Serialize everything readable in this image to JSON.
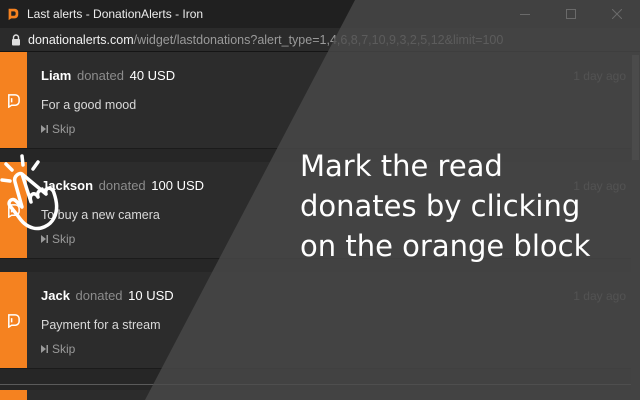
{
  "window": {
    "title": "Last alerts - DonationAlerts - Iron",
    "icon": "donationalerts-logo-icon",
    "accent": "#f58220"
  },
  "address": {
    "host": "donationalerts.com",
    "path": "/widget/lastdonations?alert_type=1,4,6,8,7,10,9,3,2,5,12&limit=100"
  },
  "donations": [
    {
      "name": "Liam",
      "verb": "donated",
      "amount": "40 USD",
      "time": "1 day ago",
      "message": "For a good mood",
      "skip": "Skip"
    },
    {
      "name": "Jackson",
      "verb": "donated",
      "amount": "100 USD",
      "time": "1 day ago",
      "message": "To buy a new camera",
      "skip": "Skip"
    },
    {
      "name": "Jack",
      "verb": "donated",
      "amount": "10 USD",
      "time": "1 day ago",
      "message": "Payment for a stream",
      "skip": "Skip"
    }
  ],
  "caption": {
    "line1": "Mark the read",
    "line2": "donates by clicking",
    "line3": "on the orange block"
  }
}
